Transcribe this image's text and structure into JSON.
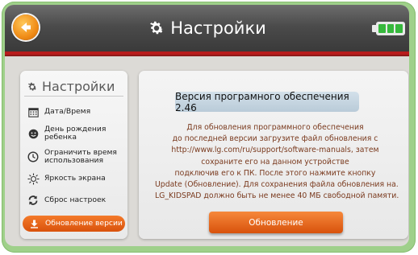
{
  "header": {
    "title": "Настройки",
    "back_icon": "back-arrow-icon",
    "settings_icon": "gear-icon",
    "battery_icon": "battery-icon",
    "battery_level": 1.0
  },
  "sidebar": {
    "title": "Настройки",
    "items": [
      {
        "label": "Дата/Время",
        "icon": "calendar-icon"
      },
      {
        "label": "День рождения ребенка",
        "line1": "День рождения",
        "line2": "ребенка",
        "icon": "child-face-icon"
      },
      {
        "label": "Ограничить время использования",
        "line1": "Ограничить время",
        "line2": "использования",
        "icon": "clock-icon"
      },
      {
        "label": "Яркость экрана",
        "icon": "sun-icon"
      },
      {
        "label": "Сброс настроек",
        "icon": "reset-arrows-icon"
      },
      {
        "label": "Обновление версии",
        "icon": "download-icon",
        "active": true
      }
    ]
  },
  "main": {
    "version_text": "Версия програмного обеспечения 2.46",
    "info_lines": [
      "Для обновления программного обеспечения",
      "до последней версии загрузите файл обновления с",
      "http://www.lg.com/ru/support/software-manuals, затем",
      "сохраните его на данном устройстве",
      "подключив его к ПК. После этого нажмите кнопку",
      "Update (Обновление). Для сохранения файла обновления на.",
      "LG_KIDSPAD должно быть не менее 40 МБ свободной памяти."
    ],
    "update_button": "Обновление"
  },
  "colors": {
    "accent": "#e8651a",
    "header_bg": "#4b4b4b",
    "header_line": "#b81c1c",
    "frame": "#9fd08a",
    "battery": "#36b83c"
  }
}
